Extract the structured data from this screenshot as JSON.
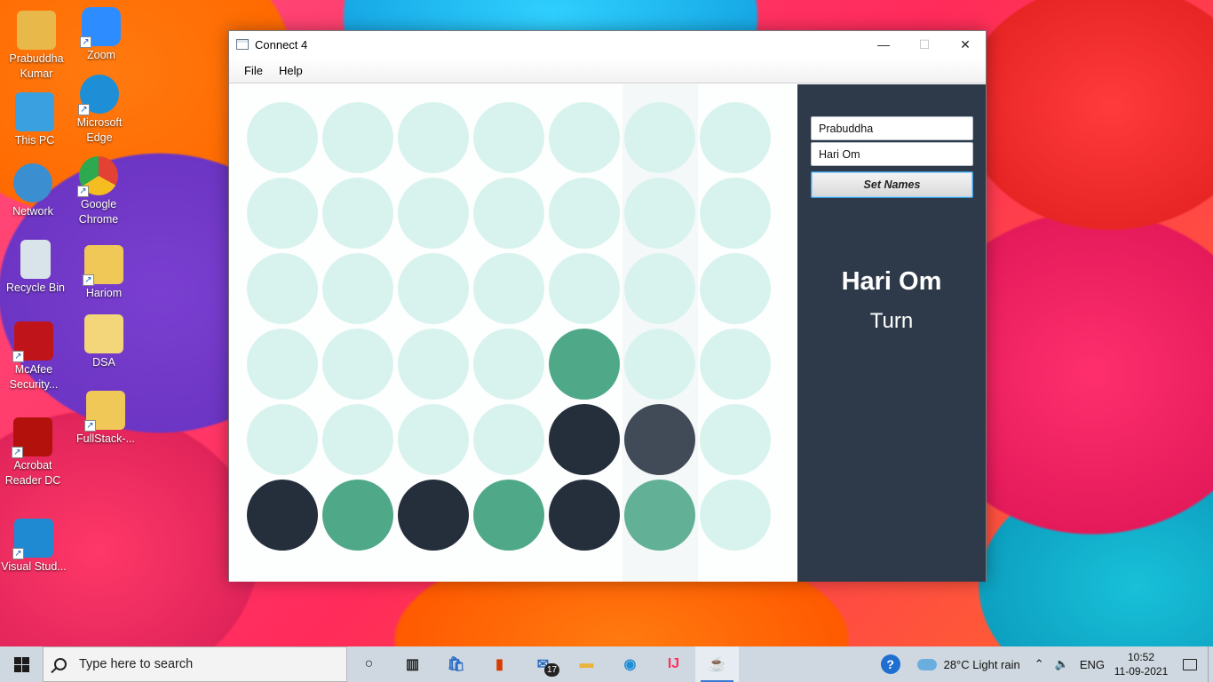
{
  "desktop": {
    "icons": [
      {
        "label": "Prabuddha Kumar",
        "icon": "user-folder-icon",
        "color": "#e8b84a"
      },
      {
        "label": "Zoom",
        "icon": "zoom-icon",
        "color": "#2d8cff"
      },
      {
        "label": "This PC",
        "icon": "computer-icon",
        "color": "#3aa0e0"
      },
      {
        "label": "Microsoft Edge",
        "icon": "edge-icon",
        "color": "#1e8fd6"
      },
      {
        "label": "Network",
        "icon": "network-icon",
        "color": "#3b8fd0"
      },
      {
        "label": "Google Chrome",
        "icon": "chrome-icon",
        "color": "#e34133"
      },
      {
        "label": "Recycle Bin",
        "icon": "recycle-bin-icon",
        "color": "#d9e4ea"
      },
      {
        "label": "Hariom",
        "icon": "document-folder-icon",
        "color": "#f0c858"
      },
      {
        "label": "McAfee Security...",
        "icon": "mcafee-icon",
        "color": "#c0141b"
      },
      {
        "label": "DSA",
        "icon": "folder-icon",
        "color": "#f3d57a"
      },
      {
        "label": "FullStack-...",
        "icon": "folder-icon",
        "color": "#f0c858"
      },
      {
        "label": "Acrobat Reader DC",
        "icon": "acrobat-icon",
        "color": "#b3120c"
      },
      {
        "label": "Visual Stud...",
        "icon": "vscode-icon",
        "color": "#1f8ad2"
      }
    ]
  },
  "window": {
    "title": "Connect 4",
    "controls": {
      "minimize": "—",
      "maximize": "☐",
      "close": "✕"
    },
    "menu": [
      "File",
      "Help"
    ]
  },
  "board": {
    "rows": 6,
    "cols": 7,
    "colors": {
      "empty": "#d8f3ee",
      "green": "#4fa988",
      "green_light": "#62b095",
      "dark": "#252f3c",
      "dark_light": "#414b58"
    },
    "cells": [
      [
        "empty",
        "empty",
        "empty",
        "empty",
        "empty",
        "empty",
        "empty"
      ],
      [
        "empty",
        "empty",
        "empty",
        "empty",
        "empty",
        "empty",
        "empty"
      ],
      [
        "empty",
        "empty",
        "empty",
        "empty",
        "empty",
        "empty",
        "empty"
      ],
      [
        "empty",
        "empty",
        "empty",
        "empty",
        "green",
        "empty",
        "empty"
      ],
      [
        "empty",
        "empty",
        "empty",
        "empty",
        "dark",
        "dark_light",
        "empty"
      ],
      [
        "dark",
        "green",
        "dark",
        "green",
        "dark",
        "green_light",
        "empty"
      ]
    ]
  },
  "sidebar": {
    "player1": "Prabuddha",
    "player2": "Hari Om",
    "set_names_label": "Set Names",
    "current_player": "Hari Om",
    "turn_label": "Turn"
  },
  "taskbar": {
    "search_placeholder": "Type here to search",
    "apps": [
      {
        "name": "cortana",
        "glyph": "○"
      },
      {
        "name": "task-view",
        "glyph": "▥"
      },
      {
        "name": "store",
        "glyph": "🛍"
      },
      {
        "name": "office",
        "glyph": "▮"
      },
      {
        "name": "mail",
        "glyph": "✉",
        "badge": "17"
      },
      {
        "name": "file-explorer",
        "glyph": "▬"
      },
      {
        "name": "edge",
        "glyph": "◉"
      },
      {
        "name": "intellij",
        "glyph": "IJ"
      },
      {
        "name": "java",
        "glyph": "☕",
        "active": true
      }
    ],
    "help_glyph": "?",
    "weather": "28°C  Light rain",
    "language": "ENG",
    "time": "10:52",
    "date": "11-09-2021"
  }
}
